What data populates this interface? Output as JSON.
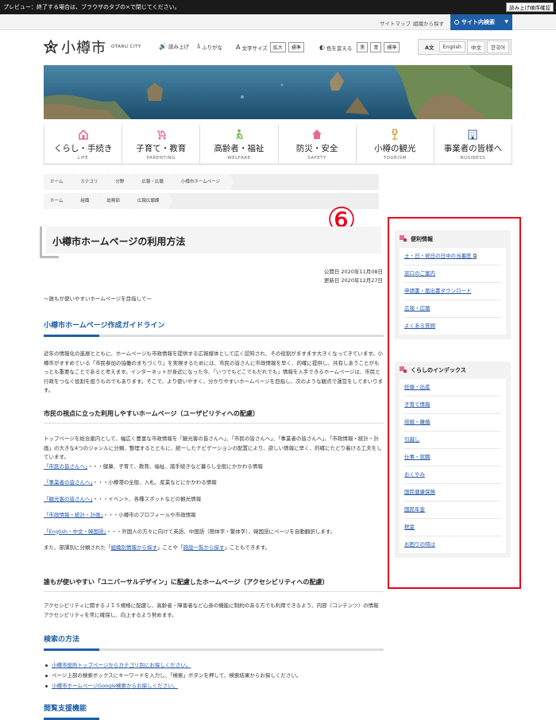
{
  "preview_bar": {
    "text": "プレビュー：終了する場合は、ブラウザのタブの×で閉じてください。",
    "button": "読み上げ順序確認"
  },
  "utility": {
    "sitemap": "サイトマップ",
    "org_search": "組織から探す",
    "site_search": "サイト内検索"
  },
  "logo": {
    "name": "小樽市",
    "sub": "OTARU CITY"
  },
  "tools": {
    "read_aloud": "読み上げ",
    "furigana": "ふりがな",
    "font_size": "文字サイズ",
    "enlarge": "拡大",
    "standard": "標準",
    "color": "色を変える",
    "black": "黒",
    "blue": "青",
    "color_standard": "標準"
  },
  "languages": [
    "English",
    "中文",
    "한국어"
  ],
  "nav": [
    {
      "jp": "くらし・手続き",
      "en": "LIFE",
      "icon": "house-key-icon"
    },
    {
      "jp": "子育て・教育",
      "en": "PARENTING",
      "icon": "stroller-icon"
    },
    {
      "jp": "高齢者・福祉",
      "en": "WELFARE",
      "icon": "walking-person-icon"
    },
    {
      "jp": "防災・安全",
      "en": "SAFETY",
      "icon": "shield-house-icon"
    },
    {
      "jp": "小樽の観光",
      "en": "TOURISM",
      "icon": "lamp-icon"
    },
    {
      "jp": "事業者の皆様へ",
      "en": "BUSINESS",
      "icon": "building-icon"
    }
  ],
  "breadcrumb1": [
    "ホーム",
    "カテゴリ",
    "分野",
    "広報・広聴",
    "小樽市ホームページ"
  ],
  "breadcrumb2": [
    "ホーム",
    "組織",
    "総務部",
    "広報広聴課"
  ],
  "annotation": "⑥",
  "page": {
    "title": "小樽市ホームページの利用方法",
    "published": "公開日 2020年11月08日",
    "updated": "更新日 2020年12月27日",
    "tagline": "～誰もが使いやすいホームページを目指して～",
    "sec1_title": "小樽市ホームページ作成ガイドライン",
    "sec1_body": "近年の情報化の進展とともに、ホームページも市政情報を提供する広報媒体として広く認知され、その役割がますます大きくなってきています。小樽市がすすめている「市民参加の協働のまちづくり」を実現するためには、市民の皆さんに市政情報を早く、的確に提供し、共有しあうことがもっとも重要なことであると考えます。インターネットが身近になった今、「いつでもどこでもだれでも」情報を入手できるホームページは、市民と行政をつなぐ役割を担うものでもあります。そこで、より使いやすく、分かりやすいホームページを目指し、次のような観点で運営をしてまいります。",
    "sec2_title": "市民の視点に立った利用しやすいホームページ（ユーザビリティへの配慮）",
    "sec2_body": "トップページを総合案内として、幅広く豊富な市政情報を「観光客の皆さんへ」、「市民の皆さんへ」、「事業者の皆さんへ」、「市政情報・統計・計画」の大きな4つのジャンルに分類、整理するとともに、統一したナビゲーションの配置により、欲しい情報に早く、的確にたどり着ける工夫をしています。",
    "sec2_items": [
      {
        "link": "「市民の皆さんへ」",
        "text": "・・・健康、子育て、教育、福祉、諸手続きなど暮らし全般にかかわる情報"
      },
      {
        "link": "「事業者の皆さんへ」",
        "text": "・・・小樽港の全般、入札、産業などにかかわる情報"
      },
      {
        "link": "「観光客の皆さんへ」",
        "text": "・・・イベント、各種スポットなどの観光情報"
      },
      {
        "link": "「市政情報・統計・計画」",
        "text": "・・・小樽市のプロフィールや市政情報"
      },
      {
        "link": "「English・中文・韓国語」",
        "text": "・・・外国人の方々に向けて英語、中国語（簡体字・繁体字）、韓国語にページを自動翻訳します。"
      }
    ],
    "sec2_tail_a": "また、部課別に分類された「",
    "sec2_tail_link1": "組織別情報から探す",
    "sec2_tail_b": "」ことや「",
    "sec2_tail_link2": "施設一覧から探す",
    "sec2_tail_c": "」こともできます。",
    "sec3_title": "誰もが使いやすい「ユニバーサルデザイン」に配慮したホームページ（アクセシビリティへの配慮）",
    "sec3_body": "アクセシビリティに関するＪＩＳ規格に配慮し、高齢者・障害者など心身の機能に制約のある方でも利用できるよう、内容（コンテンツ）の情報アクセシビリティを常に確保し、向上するよう努めます。",
    "sec4_title": "検索の方法",
    "sec4_items": [
      {
        "text": "小樽市役所トップページからカテゴリ別にお探しください。",
        "link": true
      },
      {
        "text": "ページ上部の検索ボックスにキーワードを入力し、「検索」ボタンを押して、検索結果からお探しください。",
        "link": false
      },
      {
        "text": "小樽市ホームページGoogle検索からお探しください。",
        "link": true
      }
    ],
    "sec5_title": "閲覧支援機能"
  },
  "side": {
    "box1_title": "便利情報",
    "box1_items": [
      "土・日・祝日の日中の当番医",
      "窓口のご案内",
      "申請書・届出書ダウンロード",
      "広報・広聴",
      "よくある質問"
    ],
    "box2_title": "くらしのインデックス",
    "box2_items": [
      "妊娠・出産",
      "子育て情報",
      "結婚・離婚",
      "引越し",
      "仕事・就職",
      "おくやみ",
      "国民健康保険",
      "国民年金",
      "税金",
      "お困りの時は"
    ]
  },
  "colors": {
    "accent": "#1e5fa6",
    "annotation": "#e8001c",
    "side_marker": "#e76b93"
  }
}
